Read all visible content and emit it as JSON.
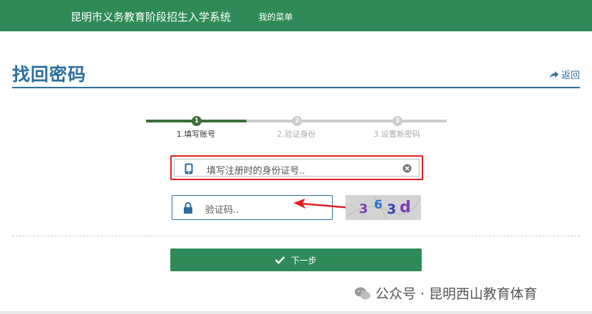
{
  "header": {
    "brand": "昆明市义务教育阶段招生入学系统",
    "menu_label": "我的菜单"
  },
  "page": {
    "title": "找回密码",
    "back_label": "返回"
  },
  "steps": [
    {
      "number": "1",
      "label": "1.填写账号",
      "active": true
    },
    {
      "number": "2",
      "label": "2.验证身份",
      "active": false
    },
    {
      "number": "3",
      "label": "3.设置新密码",
      "active": false
    }
  ],
  "form": {
    "id_placeholder": "填写注册时的身份证号..",
    "code_placeholder": "验证码..",
    "captcha_text": [
      "3",
      "6",
      "3",
      "d"
    ],
    "next_label": "下一步"
  },
  "watermark": {
    "text": "公众号 · 昆明西山教育体育"
  },
  "colors": {
    "nav": "#2e8b57",
    "title": "#2c6e9e",
    "step_active": "#3a6e3a",
    "step_inactive": "#cccccc",
    "highlight": "#e02020"
  },
  "icons": {
    "back": "share-arrow-icon",
    "id_field": "mobile-phone-icon",
    "clear": "clear-circle-icon",
    "code_field": "lock-icon",
    "next": "check-icon",
    "watermark": "wechat-icon"
  }
}
